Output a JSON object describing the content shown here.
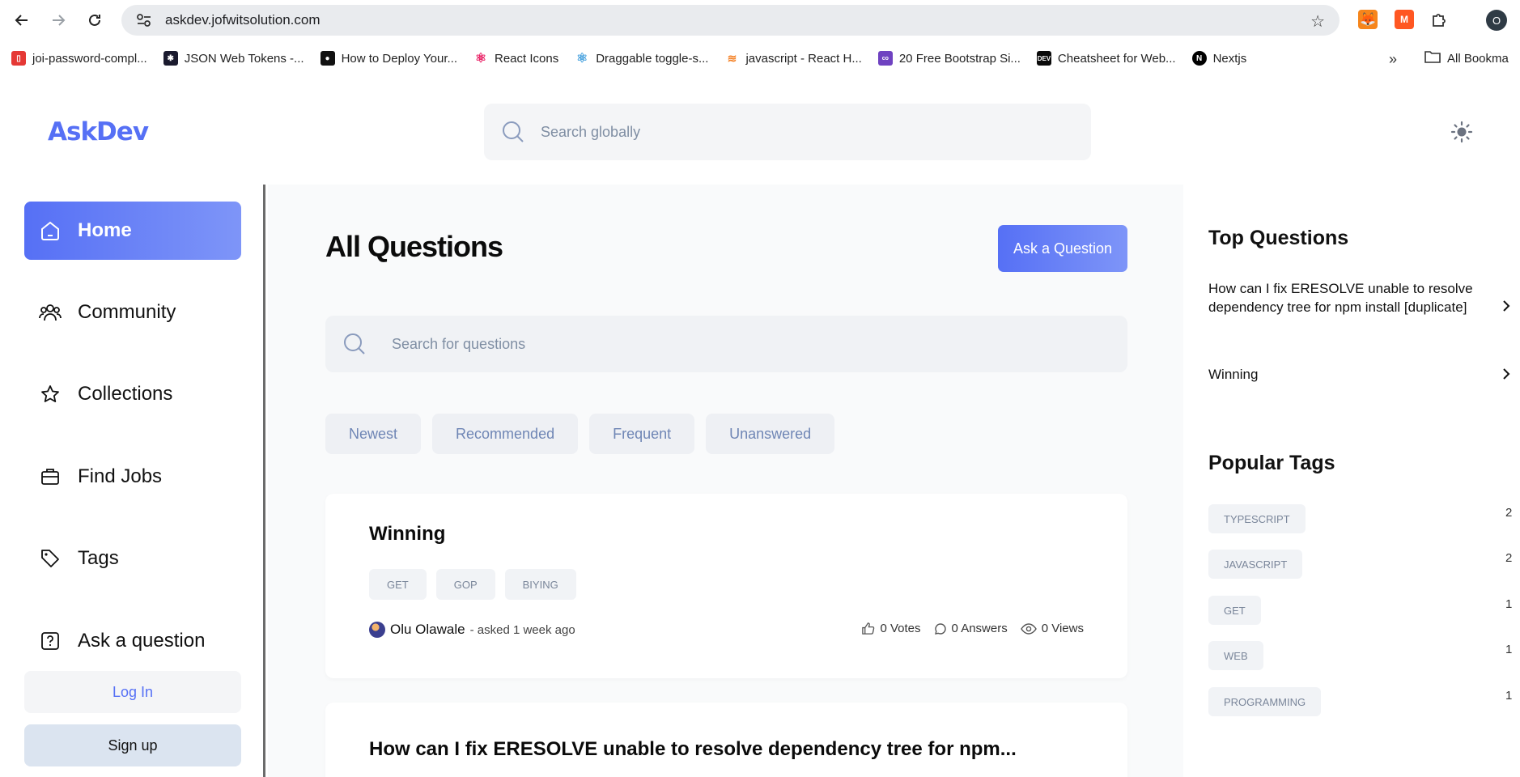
{
  "browser": {
    "url": "askdev.jofwitsolution.com",
    "profile_initial": "O",
    "bookmarks": [
      {
        "label": "joi-password-compl...",
        "color": "#e53935"
      },
      {
        "label": "JSON Web Tokens -...",
        "color": "#1a1a2e"
      },
      {
        "label": "How to Deploy Your...",
        "color": "#111111"
      },
      {
        "label": "React Icons",
        "color": "#e91e63"
      },
      {
        "label": "Draggable toggle-s...",
        "color": "#4aa3df"
      },
      {
        "label": "javascript - React H...",
        "color": "#f48024"
      },
      {
        "label": "20 Free Bootstrap Si...",
        "color": "#6f42c1"
      },
      {
        "label": "Cheatsheet for Web...",
        "color": "#0a0a0a"
      },
      {
        "label": "Nextjs",
        "color": "#000000"
      }
    ],
    "all_bookmarks": "All Bookma"
  },
  "header": {
    "logo": "AskDev",
    "search_placeholder": "Search globally"
  },
  "sidebar": {
    "items": [
      {
        "label": "Home",
        "icon": "home-icon",
        "active": true
      },
      {
        "label": "Community",
        "icon": "users-icon"
      },
      {
        "label": "Collections",
        "icon": "star-icon"
      },
      {
        "label": "Find Jobs",
        "icon": "briefcase-icon"
      },
      {
        "label": "Tags",
        "icon": "tag-icon"
      },
      {
        "label": "Ask a question",
        "icon": "question-icon"
      }
    ],
    "login_label": "Log In",
    "signup_label": "Sign up"
  },
  "main": {
    "title": "All Questions",
    "ask_button": "Ask a Question",
    "search_placeholder": "Search for questions",
    "filters": [
      "Newest",
      "Recommended",
      "Frequent",
      "Unanswered"
    ],
    "questions": [
      {
        "title": "Winning",
        "tags": [
          "GET",
          "GOP",
          "BIYING"
        ],
        "author": "Olu Olawale",
        "asked": "- asked 1 week ago",
        "votes": "0 Votes",
        "answers": "0 Answers",
        "views": "0 Views"
      },
      {
        "title": "How can I fix ERESOLVE unable to resolve dependency tree for npm..."
      }
    ]
  },
  "right": {
    "top_questions_title": "Top Questions",
    "top_questions": [
      "How can I fix ERESOLVE unable to resolve dependency tree for npm install [duplicate]",
      "Winning"
    ],
    "popular_tags_title": "Popular Tags",
    "popular_tags": [
      {
        "name": "TYPESCRIPT",
        "count": "2"
      },
      {
        "name": "JAVASCRIPT",
        "count": "2"
      },
      {
        "name": "GET",
        "count": "1"
      },
      {
        "name": "WEB",
        "count": "1"
      },
      {
        "name": "PROGRAMMING",
        "count": "1"
      }
    ]
  },
  "colors": {
    "accent": "#5670f5",
    "page_bg": "#f9fafb"
  }
}
